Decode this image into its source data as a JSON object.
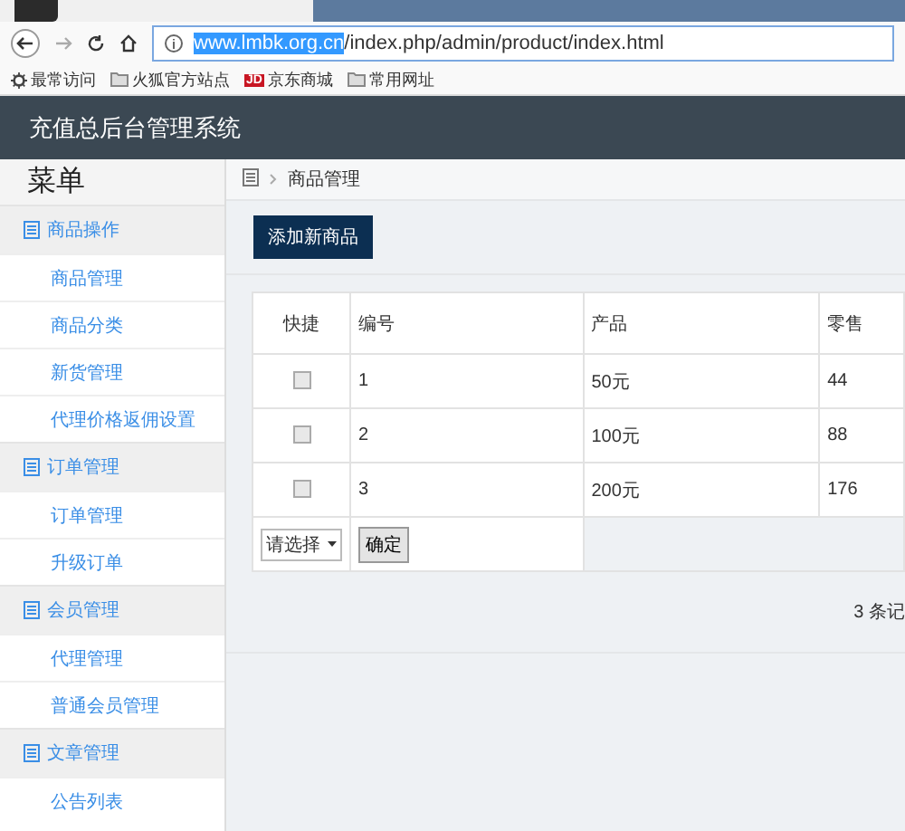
{
  "browser": {
    "address": {
      "host": "www.lmbk.org.cn",
      "path": "/index.php/admin/product/index.html"
    },
    "bookmarks": [
      {
        "kind": "gear",
        "label": "最常访问"
      },
      {
        "kind": "folder",
        "label": "火狐官方站点"
      },
      {
        "kind": "jd",
        "label": "京东商城",
        "badge": "JD"
      },
      {
        "kind": "folder",
        "label": "常用网址"
      }
    ]
  },
  "header": {
    "title": "充值总后台管理系统"
  },
  "sidebar": {
    "title": "菜单",
    "groups": [
      {
        "label": "商品操作",
        "items": [
          {
            "label": "商品管理"
          },
          {
            "label": "商品分类"
          },
          {
            "label": "新货管理"
          },
          {
            "label": "代理价格返佣设置"
          }
        ]
      },
      {
        "label": "订单管理",
        "items": [
          {
            "label": "订单管理"
          },
          {
            "label": "升级订单"
          }
        ]
      },
      {
        "label": "会员管理",
        "items": [
          {
            "label": "代理管理"
          },
          {
            "label": "普通会员管理"
          }
        ]
      },
      {
        "label": "文章管理",
        "items": [
          {
            "label": "公告列表"
          }
        ]
      }
    ]
  },
  "breadcrumb": "商品管理",
  "add_button": "添加新商品",
  "table": {
    "columns": [
      "快捷",
      "编号",
      "产品",
      "零售"
    ],
    "rows": [
      {
        "checked": false,
        "cells": [
          "",
          "1",
          "50元",
          "44"
        ]
      },
      {
        "checked": false,
        "cells": [
          "",
          "2",
          "100元",
          "88"
        ]
      },
      {
        "checked": false,
        "cells": [
          "",
          "3",
          "200元",
          "176"
        ]
      }
    ],
    "footer": {
      "select": "请选择",
      "button": "确定"
    }
  },
  "record_count": "3 条记"
}
